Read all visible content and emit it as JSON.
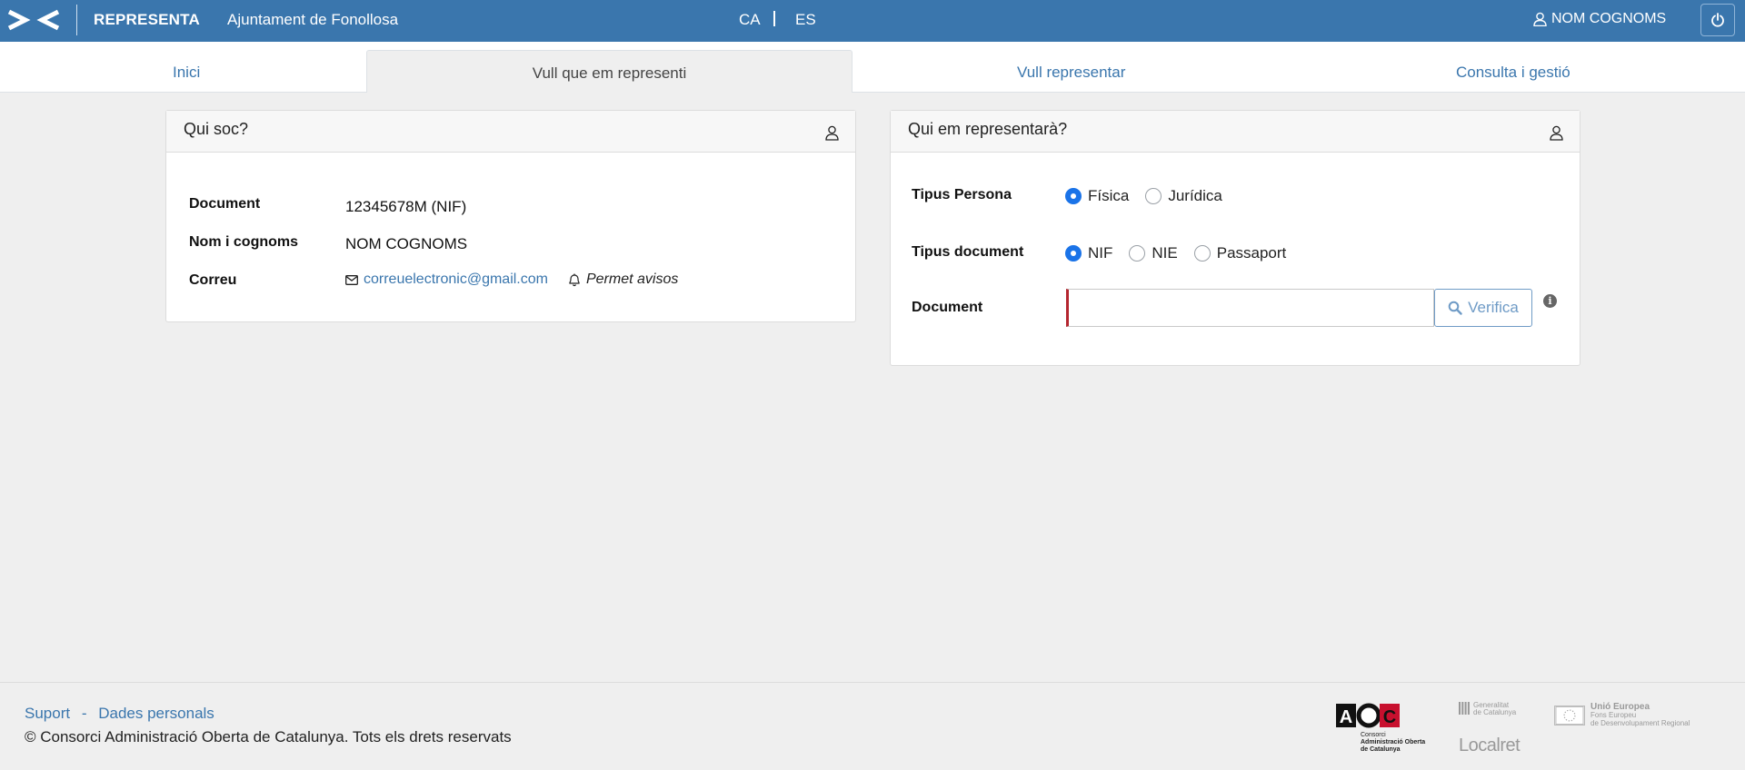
{
  "header": {
    "app_name": "REPRESENTA",
    "organization": "Ajuntament de Fonollosa",
    "languages": [
      "CA",
      "ES"
    ],
    "user_name": "NOM COGNOMS",
    "icons": [
      "brand-logo",
      "user-icon",
      "power-icon"
    ]
  },
  "tabs": [
    {
      "label": "Inici",
      "active": false
    },
    {
      "label": "Vull que em representi",
      "active": true
    },
    {
      "label": "Vull representar",
      "active": false
    },
    {
      "label": "Consulta i gestió",
      "active": false
    }
  ],
  "who_am_i": {
    "title": "Qui soc?",
    "document_label": "Document",
    "document_value": "12345678M (NIF)",
    "name_label": "Nom i cognoms",
    "name_value": "NOM COGNOMS",
    "email_label": "Correu",
    "email_value": "correuelectronic@gmail.com",
    "notifications_label": "Permet avisos"
  },
  "representative": {
    "title": "Qui em representarà?",
    "person_type_label": "Tipus Persona",
    "person_type_options": [
      "Física",
      "Jurídica"
    ],
    "person_type_selected": "Física",
    "document_type_label": "Tipus document",
    "document_type_options": [
      "NIF",
      "NIE",
      "Passaport"
    ],
    "document_type_selected": "NIF",
    "document_label": "Document",
    "document_value": "",
    "verify_label": "Verifica"
  },
  "footer": {
    "links": [
      "Suport",
      "Dades personals"
    ],
    "link_separator": "-",
    "copyright": "© Consorci Administració Oberta de Catalunya. Tots els drets reservats",
    "aoc_logo_text": "AOC",
    "aoc_caption": [
      "Consorci",
      "Administració Oberta",
      "de Catalunya"
    ],
    "gencat_text": [
      "Generalitat",
      "de Catalunya"
    ],
    "localret_text": "Localret",
    "eu_title": "Unió Europea",
    "eu_subtitle": [
      "Fons Europeu",
      "de Desenvolupament Regional"
    ]
  },
  "colors": {
    "header_bg": "#3a76ad",
    "link": "#3a76ad",
    "radio_checked": "#1a73e8",
    "input_error": "#b4262f"
  }
}
